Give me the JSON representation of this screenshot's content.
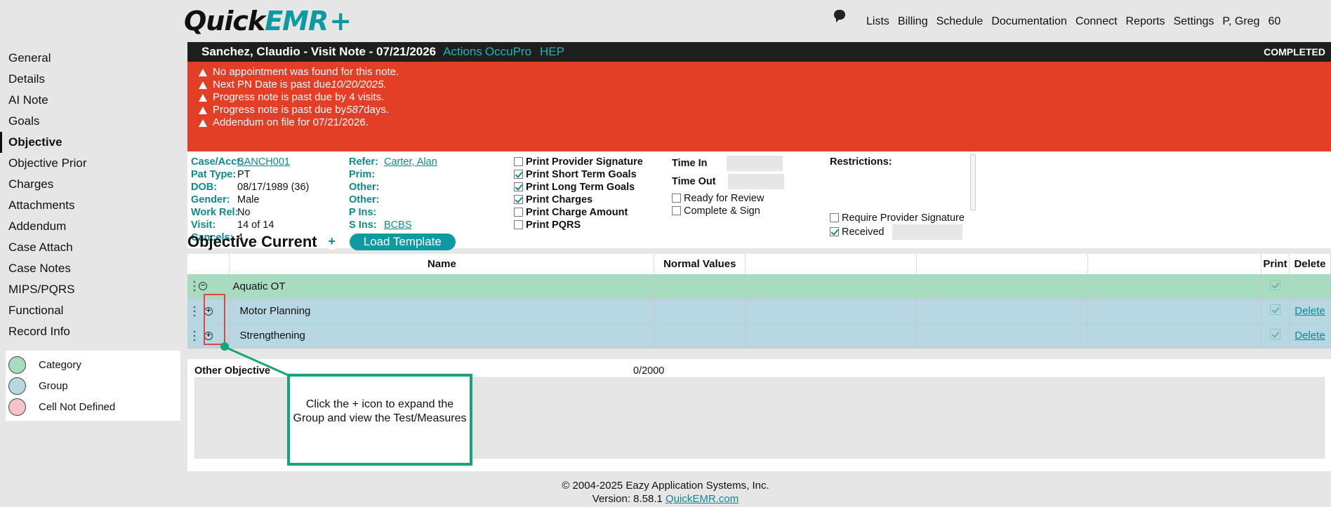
{
  "logo": {
    "quick": "Quick",
    "emr": "EMR",
    "plus": "+"
  },
  "topnav": [
    "Lists",
    "Billing",
    "Schedule",
    "Documentation",
    "Connect",
    "Reports",
    "Settings",
    "P, Greg",
    "60"
  ],
  "sidebar": [
    "General",
    "Details",
    "AI Note",
    "Goals",
    "Objective",
    "Objective Prior",
    "Charges",
    "Attachments",
    "Addendum",
    "Case Attach",
    "Case Notes",
    "MIPS/PQRS",
    "Functional",
    "Record Info"
  ],
  "legend": [
    {
      "label": "Category",
      "color": "#a8dcc1"
    },
    {
      "label": "Group",
      "color": "#b7d8e2"
    },
    {
      "label": "Cell Not Defined",
      "color": "#f6c3cb"
    }
  ],
  "titlebar": {
    "title": "Sanchez, Claudio - Visit Note - 07/21/2026",
    "actions": "Actions",
    "occupro": "OccuPro",
    "hep": "HEP",
    "status": "COMPLETED"
  },
  "alerts": [
    {
      "text": "No appointment was found for this note.",
      "em": ""
    },
    {
      "text": "Next PN Date is past due ",
      "em": "10/20/2025."
    },
    {
      "text": "Progress note is past due by 4 visits.",
      "em": ""
    },
    {
      "text": "Progress note is past due by ",
      "em": "587",
      "after": " days."
    },
    {
      "text": "Addendum on file for 07/21/2026.",
      "em": ""
    }
  ],
  "patient": [
    {
      "label": "Case/Acct:",
      "value": "SANCH001",
      "link": true
    },
    {
      "label": "Pat Type:",
      "value": "PT"
    },
    {
      "label": "DOB:",
      "value": "08/17/1989 (36)"
    },
    {
      "label": "Gender:",
      "value": "Male"
    },
    {
      "label": "Work Rel:",
      "value": "No"
    },
    {
      "label": "Visit:",
      "value": "14 of 14"
    },
    {
      "label": "Cancels:",
      "value": "4"
    }
  ],
  "referral": [
    {
      "label": "Refer:",
      "value": "Carter, Alan",
      "link": true
    },
    {
      "label": "Prim:",
      "value": ""
    },
    {
      "label": "Other:",
      "value": ""
    },
    {
      "label": "Other:",
      "value": ""
    },
    {
      "label": "P Ins:",
      "value": ""
    },
    {
      "label": "S Ins:",
      "value": "BCBS",
      "link": true
    }
  ],
  "print_options": [
    {
      "label": "Print Provider Signature",
      "checked": false
    },
    {
      "label": "Print Short Term Goals",
      "checked": true
    },
    {
      "label": "Print Long Term Goals",
      "checked": true
    },
    {
      "label": "Print Charges",
      "checked": true
    },
    {
      "label": "Print Charge Amount",
      "checked": false
    },
    {
      "label": "Print PQRS",
      "checked": false
    }
  ],
  "time": {
    "time_in": "Time In",
    "time_out": "Time Out",
    "ready": "Ready for Review",
    "complete": "Complete & Sign"
  },
  "restrictions": {
    "label": "Restrictions:",
    "require_sig": "Require Provider Signature",
    "received": "Received"
  },
  "objective": {
    "heading": "Objective Current",
    "plus": "+",
    "load_template": "Load Template"
  },
  "grid": {
    "headers": {
      "name": "Name",
      "normal": "Normal Values",
      "print": "Print",
      "delete": "Delete"
    },
    "category": "Aquatic OT",
    "groups": [
      "Motor Planning",
      "Strengthening"
    ],
    "delete_label": "Delete"
  },
  "other_objective": {
    "label": "Other Objective",
    "counter": "0/2000"
  },
  "callout": "Click the + icon to expand the Group and view the Test/Measures",
  "footer": {
    "copyright": "© 2004-2025 Eazy Application Systems, Inc.",
    "version": "Version: 8.58.1 ",
    "link": "QuickEMR.com"
  }
}
